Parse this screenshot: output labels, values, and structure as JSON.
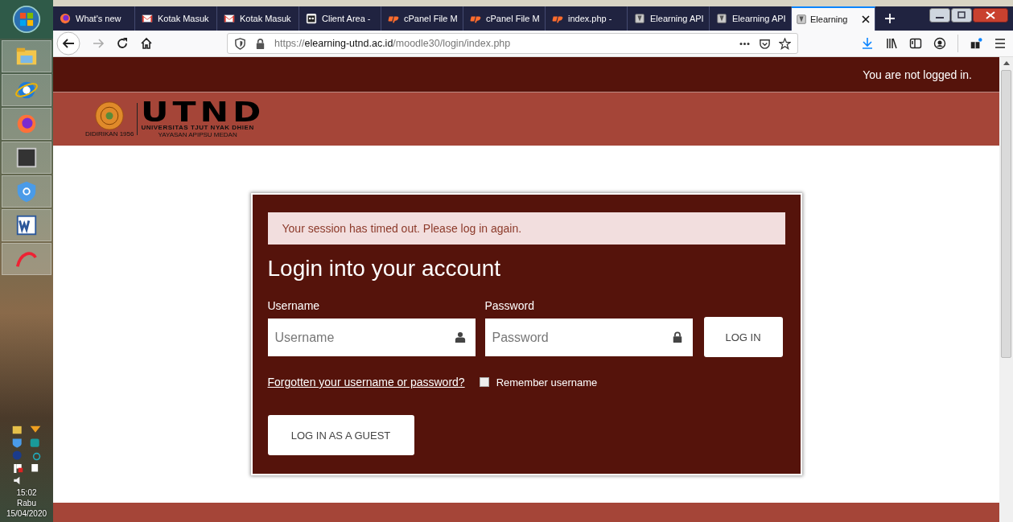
{
  "taskbar": {
    "apps": [
      {
        "kind": "folder"
      },
      {
        "kind": "ie"
      },
      {
        "kind": "firefox"
      },
      {
        "kind": "square"
      },
      {
        "kind": "shield"
      },
      {
        "kind": "word"
      },
      {
        "kind": "arc"
      }
    ],
    "clock": {
      "time": "15:02",
      "day": "Rabu",
      "date": "15/04/2020"
    }
  },
  "tabs": [
    {
      "label": "What's new",
      "kind": "firefox",
      "selected": false
    },
    {
      "label": "Kotak Masuk",
      "kind": "mail",
      "selected": false
    },
    {
      "label": "Kotak Masuk",
      "kind": "mail",
      "selected": false
    },
    {
      "label": "Client Area -",
      "kind": "robot",
      "selected": false
    },
    {
      "label": "cPanel File M",
      "kind": "cpanel",
      "selected": false
    },
    {
      "label": "cPanel File M",
      "kind": "cpanel",
      "selected": false
    },
    {
      "label": "index.php -",
      "kind": "cpanel",
      "selected": false
    },
    {
      "label": "Elearning API",
      "kind": "page",
      "selected": false
    },
    {
      "label": "Elearning API",
      "kind": "page",
      "selected": false
    },
    {
      "label": "Elearning",
      "kind": "page",
      "selected": true
    }
  ],
  "address": {
    "scheme": "https://",
    "host": "elearning-utnd.ac.id",
    "path": "/moodle30/login/index.php"
  },
  "page": {
    "login_status": "You are not logged in.",
    "logo": {
      "name": "UTND",
      "subtitle": "UNIVERSITAS TJUT NYAK DHIEN",
      "foundation": "YAYASAN APIPSU MEDAN",
      "founded": "DIDIRIKAN 1956"
    },
    "alert": "Your session has timed out. Please log in again.",
    "title": "Login into your account",
    "username": {
      "label": "Username",
      "placeholder": "Username"
    },
    "password": {
      "label": "Password",
      "placeholder": "Password"
    },
    "login_button": "LOG IN",
    "forgot_link": "Forgotten your username or password?",
    "remember": {
      "label": "Remember username",
      "checked": false
    },
    "guest_button": "LOG IN AS A GUEST"
  }
}
